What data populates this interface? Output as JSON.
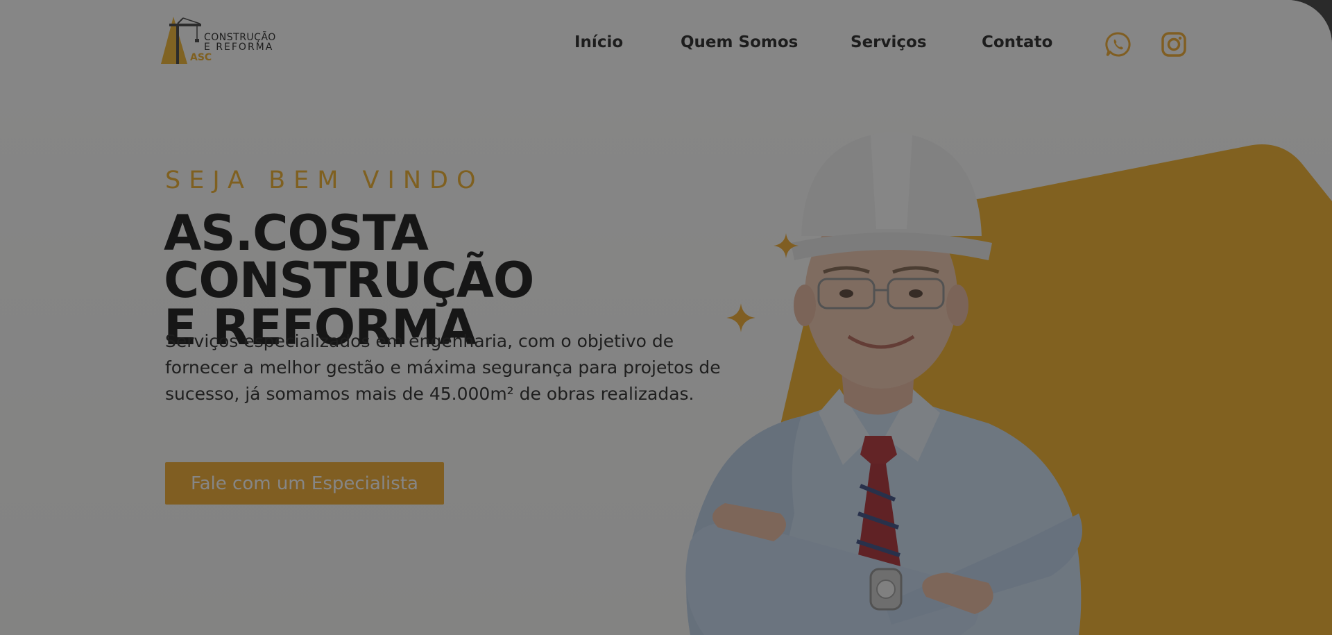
{
  "colors": {
    "accent": "#f2a51c",
    "text": "#111111",
    "shade": "rgba(40,40,40,0.56)"
  },
  "brand": {
    "line1": "CONSTRUÇÃO",
    "line2": "E REFORMA",
    "mark": "ASC"
  },
  "nav": {
    "items": [
      {
        "label": "Início"
      },
      {
        "label": "Quem Somos"
      },
      {
        "label": "Serviços"
      },
      {
        "label": "Contato"
      }
    ],
    "social": [
      {
        "icon": "whatsapp-icon"
      },
      {
        "icon": "instagram-icon"
      }
    ]
  },
  "hero": {
    "kicker": "SEJA BEM VINDO",
    "title_line1": "AS.COSTA CONSTRUÇÃO",
    "title_line2": "E REFORMA",
    "description": "Serviços especializados em engenharia, com o objetivo de fornecer a melhor gestão e máxima segurança para projetos de sucesso, já somamos mais de 45.000m² de obras realizadas.",
    "cta_label": "Fale com um Especialista"
  }
}
